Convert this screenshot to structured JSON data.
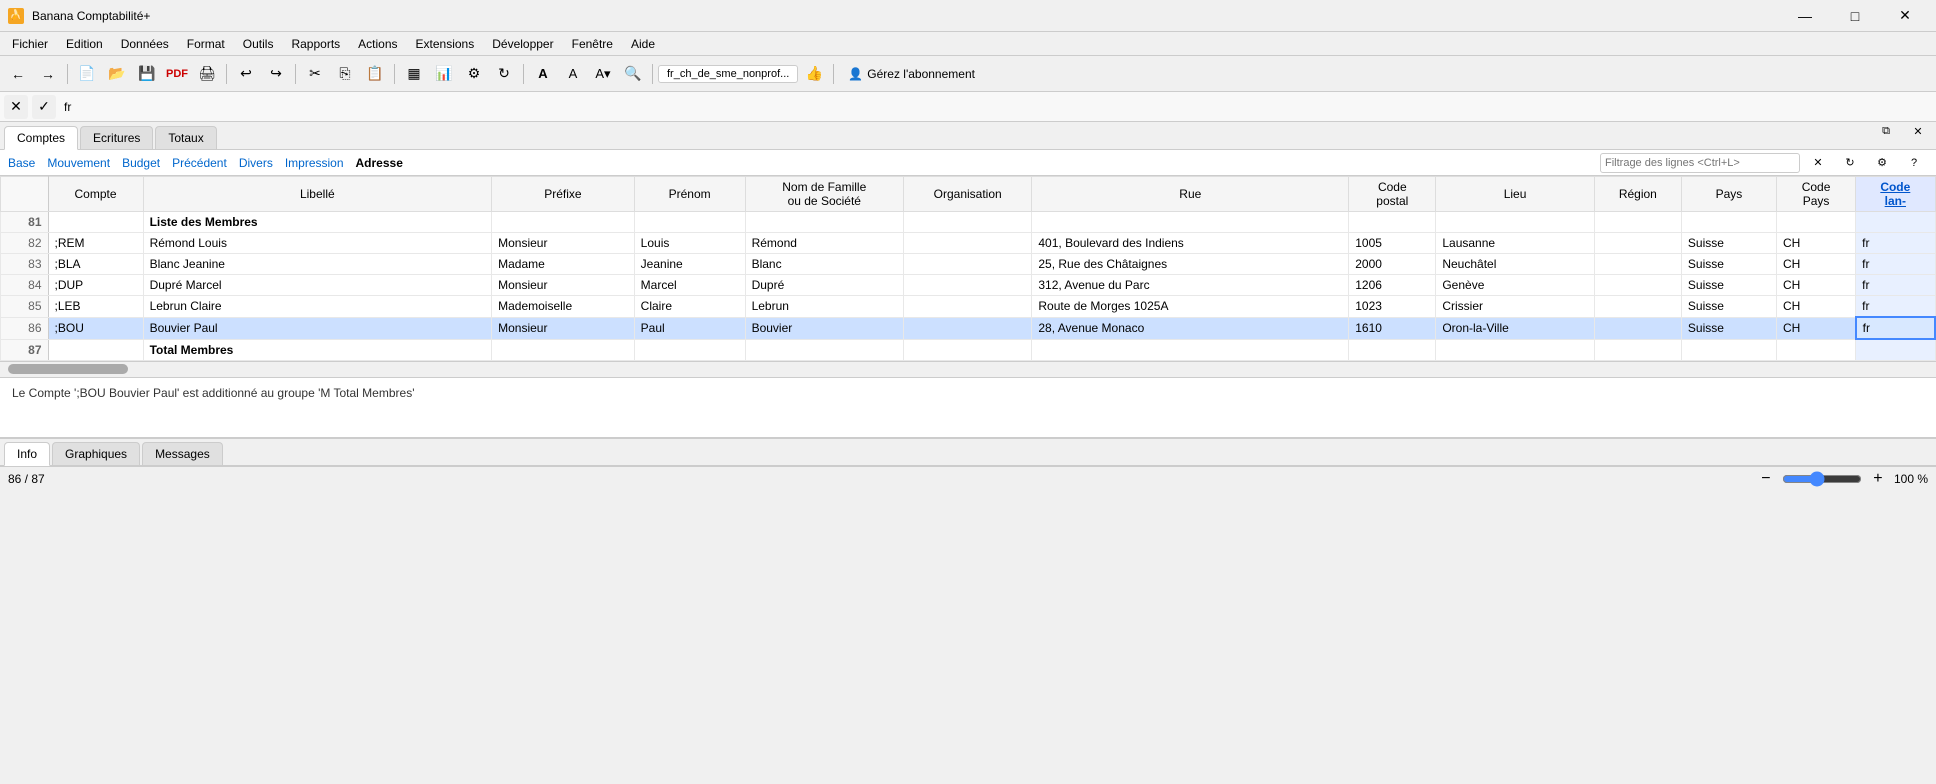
{
  "app": {
    "title": "Banana Comptabilité+",
    "icon": "🍌"
  },
  "window_controls": {
    "minimize": "—",
    "maximize": "□",
    "close": "✕"
  },
  "menu": {
    "items": [
      "Fichier",
      "Edition",
      "Données",
      "Format",
      "Outils",
      "Rapports",
      "Actions",
      "Extensions",
      "Développer",
      "Fenêtre",
      "Aide"
    ]
  },
  "toolbar": {
    "file_label": "fr_ch_de_sme_nonprof...",
    "user_label": "Gérez l'abonnement"
  },
  "formula_bar": {
    "value": "fr",
    "cancel": "✕",
    "confirm": "✓"
  },
  "tabs": {
    "main": [
      "Comptes",
      "Ecritures",
      "Totaux"
    ],
    "active": "Comptes",
    "filter_placeholder": "Filtrage des lignes <Ctrl+L>"
  },
  "sub_nav": {
    "items": [
      "Base",
      "Mouvement",
      "Budget",
      "Précédent",
      "Divers",
      "Impression",
      "Adresse"
    ],
    "active": "Adresse"
  },
  "table": {
    "columns": [
      "Compte",
      "Libellé",
      "Préfixe",
      "Prénom",
      "Nom de Famille\nou de Société",
      "Organisation",
      "Rue",
      "Code\npostal",
      "Lieu",
      "Région",
      "Pays",
      "Code\nPays",
      "Code\nlan-"
    ],
    "rows": [
      {
        "num": "81",
        "compte": "",
        "libelle": "Liste des Membres",
        "prefixe": "",
        "prenom": "",
        "nom": "",
        "org": "",
        "rue": "",
        "postal": "",
        "lieu": "",
        "region": "",
        "pays": "",
        "codepays": "",
        "codelan": "",
        "bold": true
      },
      {
        "num": "82",
        "compte": ";REM",
        "libelle": "Rémond Louis",
        "prefixe": "Monsieur",
        "prenom": "Louis",
        "nom": "Rémond",
        "org": "",
        "rue": "401, Boulevard des Indiens",
        "postal": "1005",
        "lieu": "Lausanne",
        "region": "",
        "pays": "Suisse",
        "codepays": "CH",
        "codelan": "fr",
        "bold": false
      },
      {
        "num": "83",
        "compte": ";BLA",
        "libelle": "Blanc Jeanine",
        "prefixe": "Madame",
        "prenom": "Jeanine",
        "nom": "Blanc",
        "org": "",
        "rue": "25, Rue des Châtaignes",
        "postal": "2000",
        "lieu": "Neuchâtel",
        "region": "",
        "pays": "Suisse",
        "codepays": "CH",
        "codelan": "fr",
        "bold": false
      },
      {
        "num": "84",
        "compte": ";DUP",
        "libelle": "Dupré Marcel",
        "prefixe": "Monsieur",
        "prenom": "Marcel",
        "nom": "Dupré",
        "org": "",
        "rue": "312, Avenue du Parc",
        "postal": "1206",
        "lieu": "Genève",
        "region": "",
        "pays": "Suisse",
        "codepays": "CH",
        "codelan": "fr",
        "bold": false
      },
      {
        "num": "85",
        "compte": ";LEB",
        "libelle": "Lebrun Claire",
        "prefixe": "Mademoiselle",
        "prenom": "Claire",
        "nom": "Lebrun",
        "org": "",
        "rue": "Route de Morges 1025A",
        "postal": "1023",
        "lieu": "Crissier",
        "region": "",
        "pays": "Suisse",
        "codepays": "CH",
        "codelan": "fr",
        "bold": false
      },
      {
        "num": "86",
        "compte": ";BOU",
        "libelle": "Bouvier Paul",
        "prefixe": "Monsieur",
        "prenom": "Paul",
        "nom": "Bouvier",
        "org": "",
        "rue": "28, Avenue Monaco",
        "postal": "1610",
        "lieu": "Oron-la-Ville",
        "region": "",
        "pays": "Suisse",
        "codepays": "CH",
        "codelan": "fr",
        "bold": false,
        "selected": true
      },
      {
        "num": "87",
        "compte": "",
        "libelle": "Total Membres",
        "prefixe": "",
        "prenom": "",
        "nom": "",
        "org": "",
        "rue": "",
        "postal": "",
        "lieu": "",
        "region": "",
        "pays": "",
        "codepays": "",
        "codelan": "",
        "bold": true
      }
    ]
  },
  "info": {
    "message": "Le Compte ';BOU Bouvier Paul' est additionné au groupe 'M Total Membres'"
  },
  "bottom_tabs": {
    "items": [
      "Info",
      "Graphiques",
      "Messages"
    ],
    "active": "Info"
  },
  "status_bar": {
    "position": "86 / 87",
    "zoom": "100 %"
  }
}
